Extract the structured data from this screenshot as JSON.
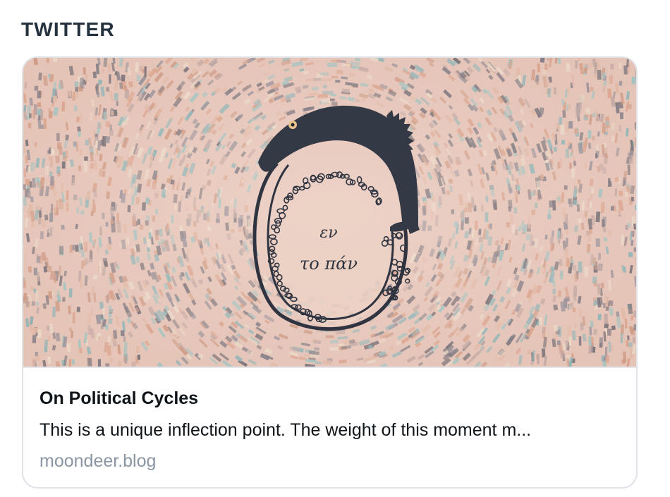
{
  "section": {
    "label": "TWITTER"
  },
  "card": {
    "title": "On Political Cycles",
    "description": "This is a unique inflection point. The weight of this moment m...",
    "domain": "moondeer.blog",
    "image": {
      "subject": "ouroboros-serpent-illustration",
      "inscription": "το πάν"
    }
  },
  "colors": {
    "heading": "#243240",
    "title": "#0f1419",
    "domain": "#8a96a3",
    "card_border": "#dfe3e8",
    "image_base": "#e9c9bd",
    "serpent": "#3a3f4b"
  }
}
